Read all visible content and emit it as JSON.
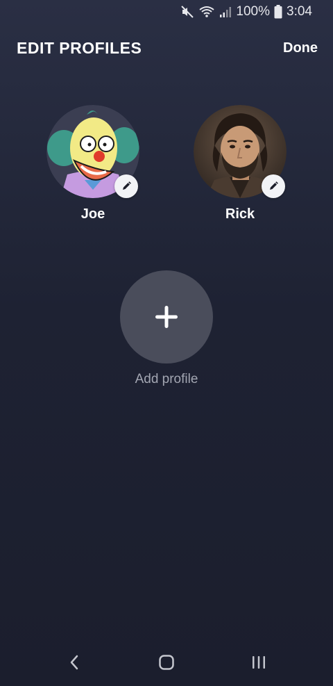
{
  "status_bar": {
    "battery": "100%",
    "time": "3:04",
    "icons": [
      "mute-icon",
      "wifi-icon",
      "signal-icon",
      "battery-icon"
    ]
  },
  "header": {
    "title": "EDIT PROFILES",
    "done_label": "Done"
  },
  "profiles": [
    {
      "name": "Joe",
      "avatar": "clown-avatar",
      "edit_icon": "pencil-icon"
    },
    {
      "name": "Rick",
      "avatar": "man-portrait-avatar",
      "edit_icon": "pencil-icon"
    }
  ],
  "add_profile": {
    "label": "Add profile",
    "icon": "plus-icon"
  },
  "nav_bar": {
    "buttons": [
      "back-icon",
      "home-icon",
      "recent-apps-icon"
    ]
  },
  "colors": {
    "background_top": "#2a2f44",
    "background_bottom": "#1b1e2d",
    "add_circle": "#4a4d5b",
    "muted_text": "#a3a6b2"
  }
}
